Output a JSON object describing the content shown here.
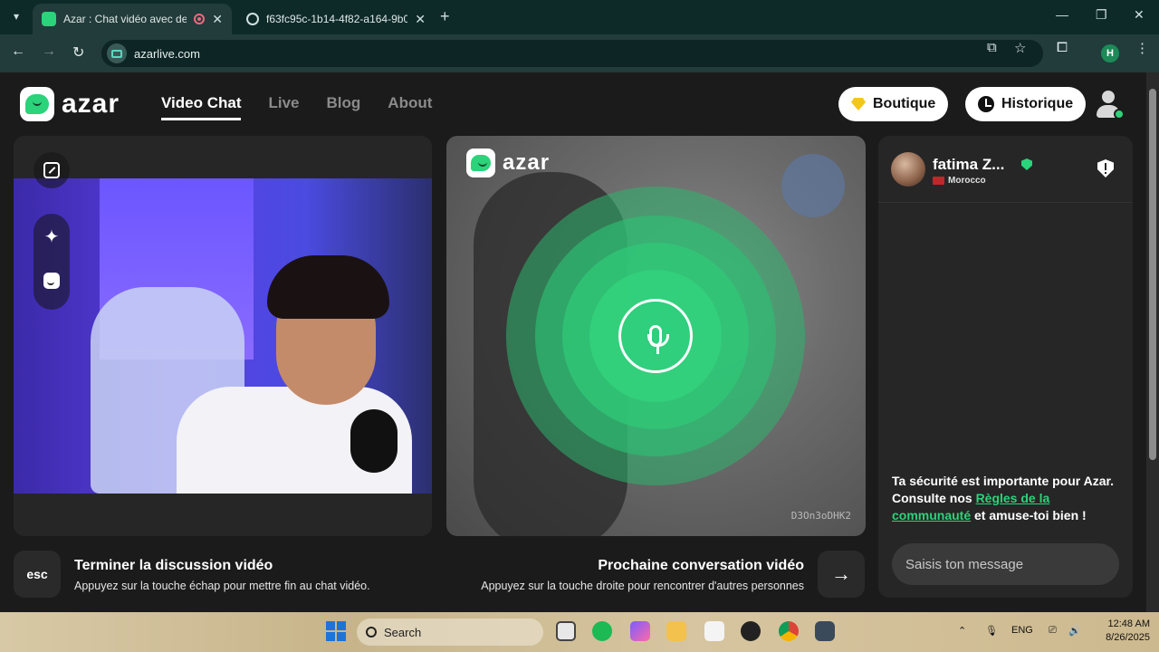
{
  "browser": {
    "tabs": [
      {
        "title": "Azar : Chat vidéo avec de no",
        "active": true
      },
      {
        "title": "f63fc95c-1b14-4f82-a164-9b0e",
        "active": false
      }
    ],
    "new_tab": "+",
    "url": "azarlive.com",
    "profile_initial": "H"
  },
  "site": {
    "logo_text": "azar",
    "nav": [
      {
        "label": "Video Chat",
        "active": true
      },
      {
        "label": "Live",
        "active": false
      },
      {
        "label": "Blog",
        "active": false
      },
      {
        "label": "About",
        "active": false
      }
    ],
    "boutique_label": "Boutique",
    "historique_label": "Historique"
  },
  "partner": {
    "logo_text": "azar",
    "id": "D3On3oDHK2"
  },
  "chat": {
    "name": "fatima Z...",
    "country": "Morocco",
    "safety_pre": "Ta sécurité est importante pour Azar. Consulte nos ",
    "safety_link": "Règles de la communauté",
    "safety_post": " et amuse-toi bien !",
    "input_placeholder": "Saisis ton message"
  },
  "hints": {
    "esc_key": "esc",
    "end_title": "Terminer la discussion vidéo",
    "end_sub": "Appuyez sur la touche échap pour mettre fin au chat vidéo.",
    "next_title": "Prochaine conversation vidéo",
    "next_sub": "Appuyez sur la touche droite pour rencontrer d'autres personnes",
    "next_arrow": "→"
  },
  "taskbar": {
    "search_label": "Search",
    "language": "ENG",
    "time": "12:48 AM",
    "date": "8/26/2025"
  },
  "colors": {
    "accent_green": "#2bd37a",
    "browser_dark": "#0d2a29",
    "page_bg": "#1b1b1b"
  }
}
